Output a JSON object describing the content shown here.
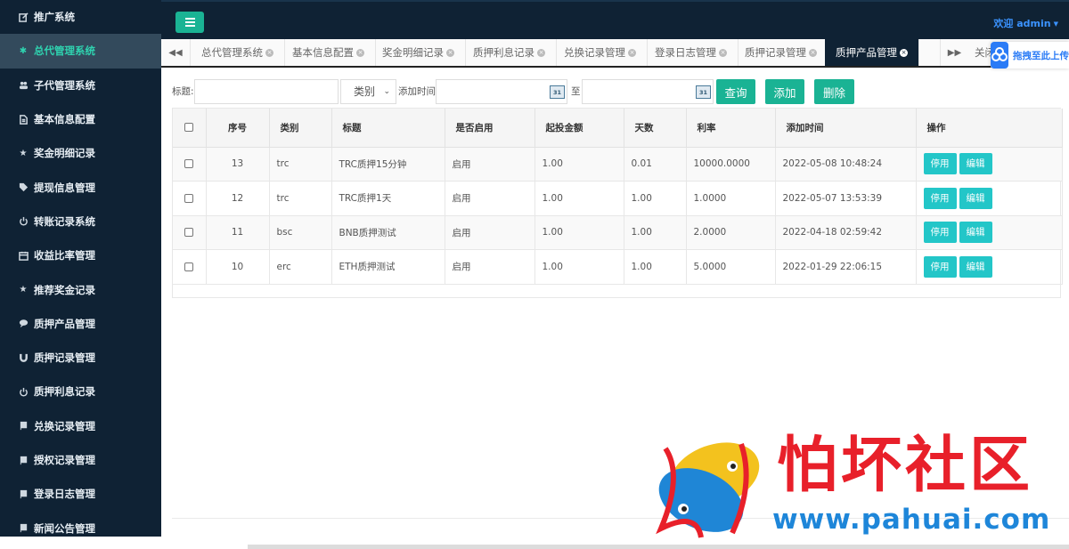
{
  "sidebar": {
    "items": [
      {
        "label": "推广系统",
        "icon": "edit-icon"
      },
      {
        "label": "总代管理系统",
        "icon": "asterisk-icon",
        "active": true
      },
      {
        "label": "子代管理系统",
        "icon": "users-icon"
      },
      {
        "label": "基本信息配置",
        "icon": "file-icon"
      },
      {
        "label": "奖金明细记录",
        "icon": "star-icon"
      },
      {
        "label": "提现信息管理",
        "icon": "tag-icon"
      },
      {
        "label": "转账记录系统",
        "icon": "power-icon"
      },
      {
        "label": "收益比率管理",
        "icon": "calendar-icon"
      },
      {
        "label": "推荐奖金记录",
        "icon": "star-icon"
      },
      {
        "label": "质押产品管理",
        "icon": "comment-icon"
      },
      {
        "label": "质押记录管理",
        "icon": "magnet-icon"
      },
      {
        "label": "质押利息记录",
        "icon": "power-icon"
      },
      {
        "label": "兑换记录管理",
        "icon": "book-icon"
      },
      {
        "label": "授权记录管理",
        "icon": "book-icon"
      },
      {
        "label": "登录日志管理",
        "icon": "book-icon"
      },
      {
        "label": "新闻公告管理",
        "icon": "book-icon"
      }
    ]
  },
  "header": {
    "welcome": "欢迎 admin"
  },
  "tabs": [
    {
      "label": "总代管理系统"
    },
    {
      "label": "基本信息配置"
    },
    {
      "label": "奖金明细记录"
    },
    {
      "label": "质押利息记录"
    },
    {
      "label": "兑换记录管理"
    },
    {
      "label": "登录日志管理"
    },
    {
      "label": "质押记录管理"
    },
    {
      "label": "质押产品管理",
      "active": true
    }
  ],
  "tab_close_label": "关闭",
  "baidu": {
    "label": "拖拽至此上传"
  },
  "search": {
    "title_label": "标题:",
    "title_value": "",
    "category_value": "类别",
    "time_label": "添加时间",
    "to_label": "至",
    "start_value": "",
    "end_value": "",
    "query_button": "查询",
    "add_button": "添加",
    "delete_button": "删除"
  },
  "table": {
    "headers": [
      "序号",
      "类别",
      "标题",
      "是否启用",
      "起投金额",
      "天数",
      "利率",
      "添加时间",
      "操作"
    ],
    "rows": [
      {
        "id": "13",
        "category": "trc",
        "title": "TRC质押15分钟",
        "enabled": "启用",
        "min_amount": "1.00",
        "days": "0.01",
        "rate": "10000.0000",
        "time": "2022-05-08 10:48:24"
      },
      {
        "id": "12",
        "category": "trc",
        "title": "TRC质押1天",
        "enabled": "启用",
        "min_amount": "1.00",
        "days": "1.00",
        "rate": "1.0000",
        "time": "2022-05-07 13:53:39"
      },
      {
        "id": "11",
        "category": "bsc",
        "title": "BNB质押测试",
        "enabled": "启用",
        "min_amount": "1.00",
        "days": "1.00",
        "rate": "2.0000",
        "time": "2022-04-18 02:59:42"
      },
      {
        "id": "10",
        "category": "erc",
        "title": "ETH质押测试",
        "enabled": "启用",
        "min_amount": "1.00",
        "days": "1.00",
        "rate": "5.0000",
        "time": "2022-01-29 22:06:15"
      }
    ],
    "disable_button": "停用",
    "edit_button": "编辑"
  },
  "watermark": {
    "cn": "怕坏社区",
    "url": "www.pahuai.com"
  },
  "colors": {
    "sidebar_bg": "#0f2234",
    "accent": "#1ab394",
    "action": "#23c6c8",
    "active_sidebar_text": "#2fd3b0",
    "welcome": "#3b93ff"
  }
}
